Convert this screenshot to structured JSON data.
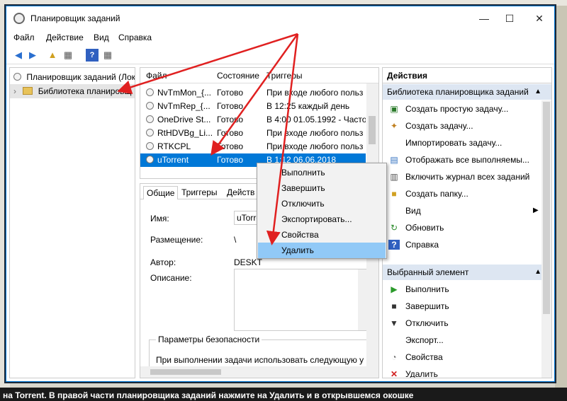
{
  "background": {
    "bottom_text": "на Torrent. В правой части планировщика заданий нажмите на Удалить и в открывшемся окошке"
  },
  "window": {
    "title": "Планировщик заданий",
    "minimize": "—",
    "maximize": "☐",
    "close": "✕"
  },
  "menu": [
    "Файл",
    "Действие",
    "Вид",
    "Справка"
  ],
  "tree": {
    "root": "Планировщик заданий (Лок",
    "library": "Библиотека планировщ"
  },
  "tasklist": {
    "headers": [
      "Файл",
      "Состояние",
      "Триггеры"
    ],
    "rows": [
      {
        "name": "NvTmMon_{...",
        "status": "Готово",
        "trigger": "При входе любого польз"
      },
      {
        "name": "NvTmRep_{...",
        "status": "Готово",
        "trigger": "В 12:25 каждый день"
      },
      {
        "name": "OneDrive St...",
        "status": "Готово",
        "trigger": "В 4:00 01.05.1992 - Часто"
      },
      {
        "name": "RtHDVBg_Li...",
        "status": "Готово",
        "trigger": "При входе любого польз"
      },
      {
        "name": "RTKCPL",
        "status": "Готово",
        "trigger": "При входе любого польз"
      },
      {
        "name": "uTorrent",
        "status": "Готово",
        "trigger": "В 1:12 06.06.2018"
      }
    ]
  },
  "details": {
    "tabs": [
      "Общие",
      "Триггеры",
      "Действ"
    ],
    "name_label": "Имя:",
    "name_value": "uTorre",
    "location_label": "Размещение:",
    "location_value": "\\",
    "author_label": "Автор:",
    "author_value": "DESKT",
    "description_label": "Описание:",
    "security_label": "Параметры безопасности",
    "security_text": "При выполнении задачи использовать следующую у"
  },
  "context_menu": [
    "Выполнить",
    "Завершить",
    "Отключить",
    "Экспортировать...",
    "Свойства",
    "Удалить"
  ],
  "actions": {
    "title": "Действия",
    "section1": "Библиотека планировщика заданий",
    "items1": [
      {
        "icon": "create-basic-task-icon",
        "label": "Создать простую задачу..."
      },
      {
        "icon": "create-task-icon",
        "label": "Создать задачу..."
      },
      {
        "icon": "import-icon",
        "label": "Импортировать задачу..."
      },
      {
        "icon": "show-running-icon",
        "label": "Отображать все выполняемы..."
      },
      {
        "icon": "enable-log-icon",
        "label": "Включить журнал всех заданий"
      },
      {
        "icon": "new-folder-icon",
        "label": "Создать папку..."
      },
      {
        "icon": "view-icon",
        "label": "Вид"
      },
      {
        "icon": "refresh-icon",
        "label": "Обновить"
      },
      {
        "icon": "help-icon",
        "label": "Справка"
      }
    ],
    "section2": "Выбранный элемент",
    "items2": [
      {
        "icon": "run-icon",
        "label": "Выполнить"
      },
      {
        "icon": "end-icon",
        "label": "Завершить"
      },
      {
        "icon": "disable-icon",
        "label": "Отключить"
      },
      {
        "icon": "export-icon",
        "label": "Экспорт..."
      },
      {
        "icon": "properties-icon",
        "label": "Свойства"
      },
      {
        "icon": "delete-icon",
        "label": "Удалить"
      }
    ]
  },
  "colors": {
    "selection": "#0078d7",
    "context_highlight": "#91c9f7",
    "section_bg": "#dde6f2",
    "annotation_arrow": "#e02020"
  }
}
